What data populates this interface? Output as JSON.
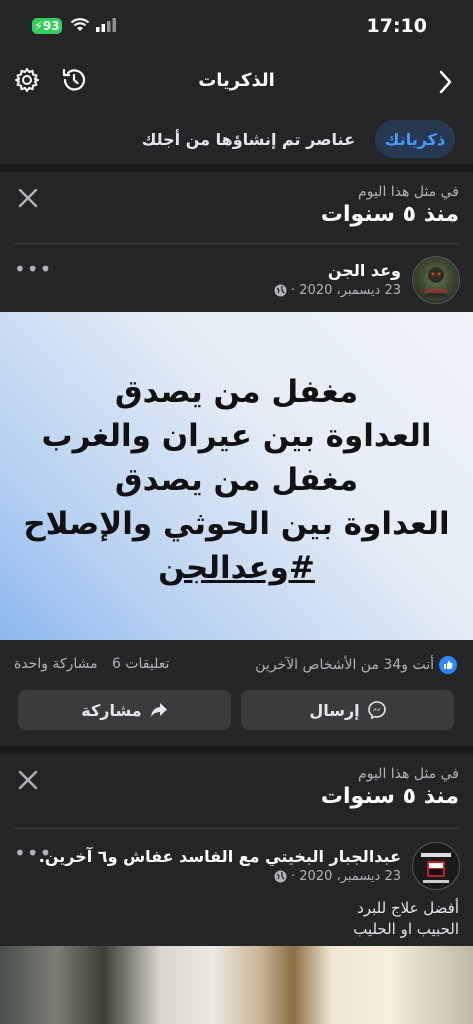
{
  "status_bar": {
    "time": "17:10",
    "battery": "93"
  },
  "header": {
    "title": "الذكريات"
  },
  "filters": {
    "active": "ذكرياتك",
    "other": "عناصر تم إنشاؤها من أجلك"
  },
  "memory1": {
    "on_this_day": "في مثل هذا اليوم",
    "years_ago": "منذ ٥ سنوات",
    "author": "وعد الجن",
    "date": "23 ديسمبر، 2020 ·",
    "image_text": [
      "مغفل من يصدق",
      "العداوة بين عيران والغرب",
      "مغفل من يصدق",
      "العداوة بين الحوثي والإصلاح"
    ],
    "hashtag": "#وعدالجن",
    "reactions": "أنت و34 من الأشخاص الآخرين",
    "comments": "6 تعليقات",
    "shares": "مشاركة واحدة",
    "send_label": "إرسال",
    "share_label": "مشاركة"
  },
  "memory2": {
    "on_this_day": "في مثل هذا اليوم",
    "years_ago": "منذ ٥ سنوات",
    "author": "عبدالجبار البخيتي مع الفاسد عفاش و٦ آخرين.",
    "date": "23 ديسمبر، 2020 ·",
    "caption_line1": "أفضل علاج للبرد",
    "caption_line2": "الحبيب  او الحليب"
  },
  "colors": {
    "accent": "#4599ff",
    "background": "#242526",
    "separator": "#18191a",
    "like": "#2d88ff"
  }
}
